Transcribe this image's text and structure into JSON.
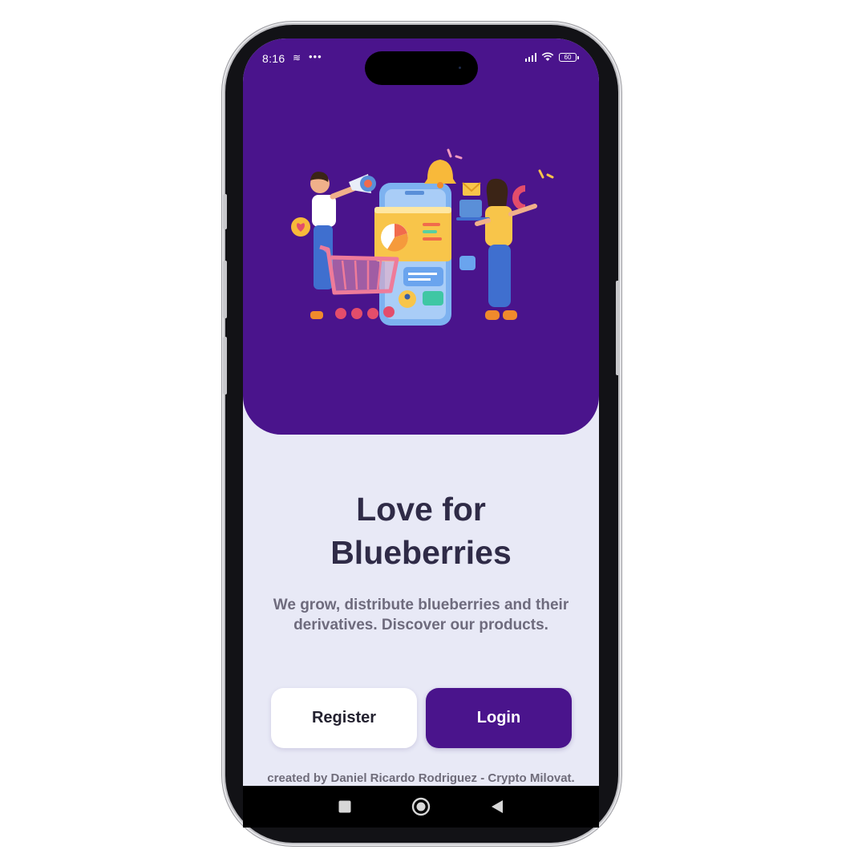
{
  "status_bar": {
    "time": "8:16",
    "notification_icons": "•••",
    "battery_level": "60"
  },
  "hero": {
    "illustration": "marketing-illustration-people-phone-cart"
  },
  "headline": {
    "line1": "Love for",
    "line2": "Blueberries"
  },
  "subtitle": "We grow, distribute blueberries and their derivatives. Discover our products.",
  "buttons": {
    "register": "Register",
    "login": "Login"
  },
  "credit": "created by Daniel Ricardo Rodriguez - Crypto Milovat.",
  "navigation": {
    "recents_icon": "square-icon",
    "home_icon": "circle-icon",
    "back_icon": "triangle-back-icon"
  },
  "colors": {
    "brand": "#4a148c",
    "background": "#e8e9f6",
    "headline": "#2f2b47",
    "subtitle": "#6e6b7d"
  }
}
